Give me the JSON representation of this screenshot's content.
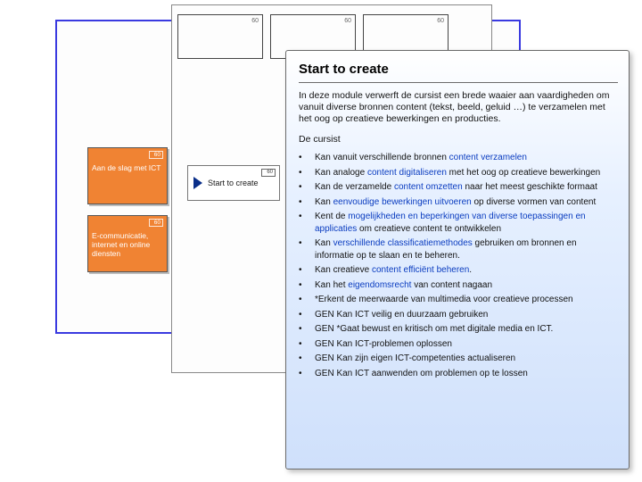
{
  "bg_card_num": "60",
  "left_cards": {
    "num": "60",
    "card1": "Aan de slag met ICT",
    "card2": "E-communicatie, internet en online diensten"
  },
  "connector": {
    "label": "Start to create",
    "num": "60"
  },
  "popup": {
    "title": "Start to create",
    "intro": "In deze module verwerft de cursist een brede waaier aan vaardigheden om vanuit diverse bronnen content (tekst, beeld, geluid …) te verzamelen met het oog op creatieve bewerkingen en producties.",
    "lead": "De cursist",
    "items": [
      {
        "pre": "Kan vanuit verschillende bronnen ",
        "hl": "content verzamelen",
        "post": ""
      },
      {
        "pre": "Kan analoge ",
        "hl": "content digitaliseren",
        "post": " met het oog op creatieve bewerkingen"
      },
      {
        "pre": "Kan de verzamelde ",
        "hl": "content omzetten",
        "post": " naar het meest geschikte formaat"
      },
      {
        "pre": "Kan ",
        "hl": "eenvoudige bewerkingen uitvoeren",
        "post": " op diverse vormen van content"
      },
      {
        "pre": "Kent de ",
        "hl": "mogelijkheden en beperkingen van diverse toepassingen en applicaties",
        "post": " om creatieve content te ontwikkelen"
      },
      {
        "pre": "Kan ",
        "hl": "verschillende classificatiemethodes",
        "post": " gebruiken om bronnen en informatie op te slaan en te beheren."
      },
      {
        "pre": "Kan creatieve ",
        "hl": "content efficiënt beheren",
        "post": "."
      },
      {
        "pre": "Kan het ",
        "hl": "eigendomsrecht",
        "post": " van content nagaan"
      },
      {
        "pre": "*Erkent de meerwaarde van multimedia voor creatieve processen",
        "hl": "",
        "post": ""
      },
      {
        "pre": "GEN Kan ICT veilig en duurzaam gebruiken",
        "hl": "",
        "post": ""
      },
      {
        "pre": "GEN *Gaat bewust en kritisch om met digitale media en ICT.",
        "hl": "",
        "post": ""
      },
      {
        "pre": "GEN Kan ICT-problemen oplossen",
        "hl": "",
        "post": ""
      },
      {
        "pre": "GEN Kan zijn eigen ICT-competenties actualiseren",
        "hl": "",
        "post": ""
      },
      {
        "pre": "GEN Kan ICT aanwenden om problemen op te lossen",
        "hl": "",
        "post": ""
      }
    ]
  }
}
